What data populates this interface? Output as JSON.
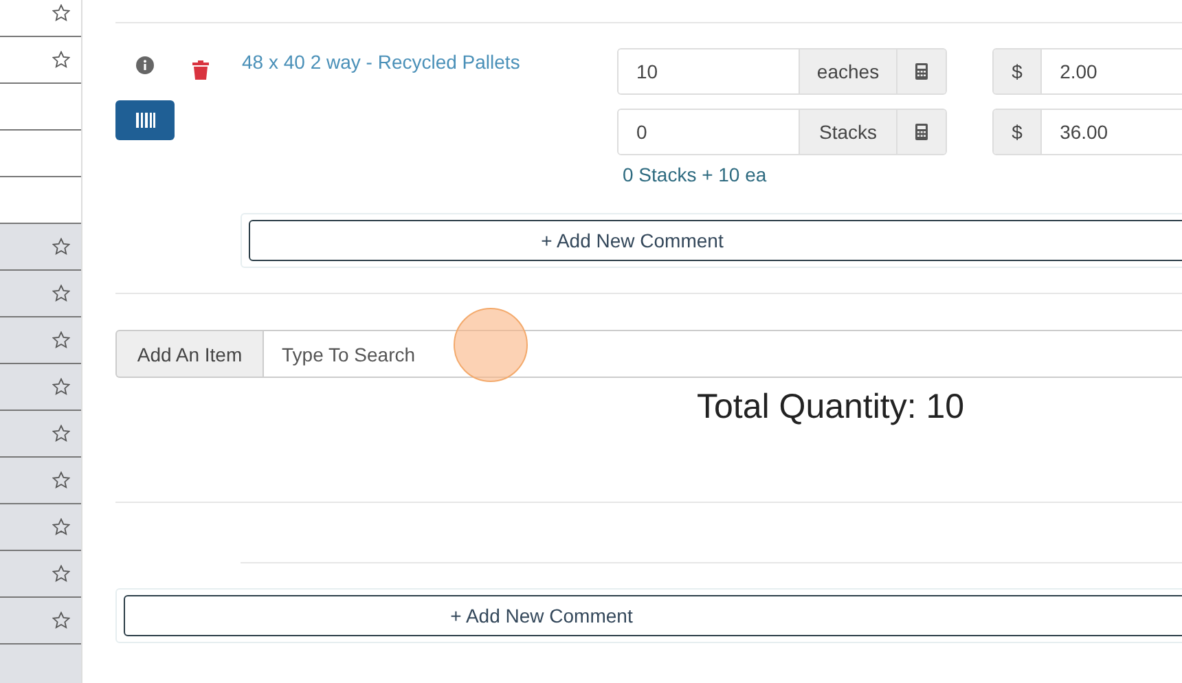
{
  "sidebar": {
    "rows": [
      {
        "star": true,
        "shaded": false
      },
      {
        "star": true,
        "shaded": false
      },
      {
        "star": false,
        "shaded": false
      },
      {
        "star": false,
        "shaded": false
      },
      {
        "star": false,
        "shaded": false
      },
      {
        "star": true,
        "shaded": true
      },
      {
        "star": true,
        "shaded": true
      },
      {
        "star": true,
        "shaded": true
      },
      {
        "star": true,
        "shaded": true
      },
      {
        "star": true,
        "shaded": true
      },
      {
        "star": true,
        "shaded": true
      },
      {
        "star": true,
        "shaded": true
      },
      {
        "star": true,
        "shaded": true
      },
      {
        "star": true,
        "shaded": true
      },
      {
        "star": false,
        "shaded": true
      }
    ]
  },
  "line_item": {
    "name": "48 x 40 2 way - Recycled Pallets",
    "quantities": [
      {
        "value": "10",
        "unit": "eaches"
      },
      {
        "value": "0",
        "unit": "Stacks"
      }
    ],
    "prices": [
      {
        "currency": "$",
        "value": "2.00"
      },
      {
        "currency": "$",
        "value": "36.00"
      }
    ],
    "summary": "0 Stacks + 10 ea",
    "comment_button": "+ Add New Comment"
  },
  "add_item": {
    "label": "Add An Item",
    "placeholder": "Type To Search"
  },
  "total": "Total Quantity:  10",
  "order_comment_button": "+ Add New Comment"
}
